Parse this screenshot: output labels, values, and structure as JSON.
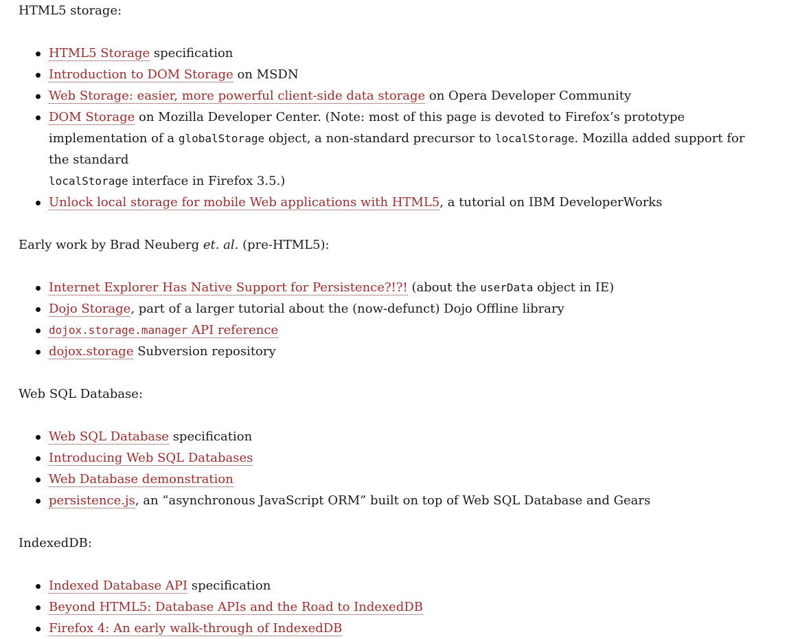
{
  "sections": [
    {
      "heading": "HTML5 storage:",
      "items": [
        {
          "link": "HTML5 Storage",
          "text": " specification"
        },
        {
          "link": "Introduction to DOM Storage",
          "text": " on MSDN"
        },
        {
          "link": "Web Storage: easier, more powerful client-side data storage",
          "text": " on Opera Developer Community"
        },
        {
          "link": "DOM Storage",
          "text1": " on Mozilla Developer Center. (Note: most of this page is devoted to Firefox’s prototype implementation of a ",
          "code1": "globalStorage",
          "text2": " object, a non-standard precursor to ",
          "code2": "localStorage",
          "text3": ". Mozilla added support for the standard ",
          "code3": "localStorage",
          "text4": " interface in Firefox 3.5.)"
        },
        {
          "link": "Unlock local storage for mobile Web applications with HTML5",
          "text": ", a tutorial on IBM DeveloperWorks"
        }
      ]
    },
    {
      "heading_part1": "Early work by Brad Neuberg ",
      "heading_italic": "et. al.",
      "heading_part2": " (pre-HTML5):",
      "items": [
        {
          "link": "Internet Explorer Has Native Support for Persistence?!?!",
          "text1": " (about the ",
          "code": "userData",
          "text2": " object in IE)"
        },
        {
          "link": "Dojo Storage",
          "text": ", part of a larger tutorial about the (now-defunct) Dojo Offline library"
        },
        {
          "link_code": "dojox.storage.manager",
          "link": " API reference"
        },
        {
          "link": "dojox.storage",
          "text": " Subversion repository"
        }
      ]
    },
    {
      "heading": "Web SQL Database:",
      "items": [
        {
          "link": "Web SQL Database",
          "text": " specification"
        },
        {
          "link": "Introducing Web SQL Databases",
          "text": ""
        },
        {
          "link": "Web Database demonstration",
          "text": ""
        },
        {
          "link": "persistence.js",
          "text": ", an “asynchronous JavaScript ORM” built on top of Web SQL Database and Gears"
        }
      ]
    },
    {
      "heading": "IndexedDB:",
      "items": [
        {
          "link": "Indexed Database API",
          "text": " specification"
        },
        {
          "link": "Beyond HTML5: Database APIs and the Road to IndexedDB",
          "text": ""
        },
        {
          "link": "Firefox 4: An early walk-through of IndexedDB",
          "text": ""
        }
      ]
    }
  ],
  "colors": {
    "link": "#a52a2a",
    "text": "#1a1a1a",
    "background": "#ffffff"
  }
}
